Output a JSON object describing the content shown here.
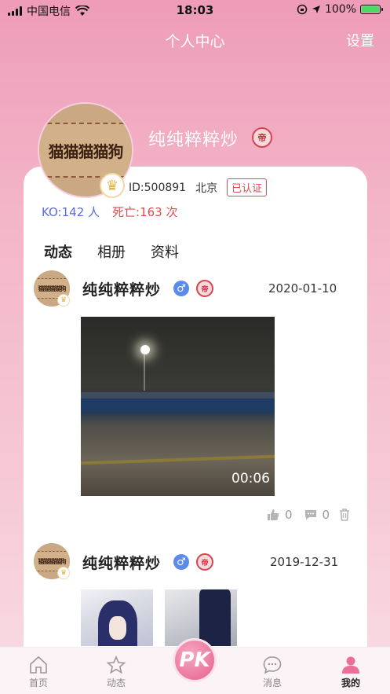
{
  "status_bar": {
    "carrier": "中国电信",
    "time": "18:03",
    "battery": "100%"
  },
  "nav": {
    "title": "个人中心",
    "settings": "设置"
  },
  "profile": {
    "avatar_text": "猫猫猫猫狗",
    "name": "纯纯粹粹炒",
    "badge_text": "帝",
    "id": "ID:500891",
    "location": "北京",
    "verified": "已认证",
    "ko": "KO:142 人",
    "death": "死亡:163 次"
  },
  "tabs": [
    "动态",
    "相册",
    "资料"
  ],
  "posts": [
    {
      "name": "纯纯粹粹炒",
      "gender": "♂",
      "date": "2020-01-10",
      "duration": "00:06",
      "likes": "0",
      "comments": "0",
      "avatar_text": "猫猫猫猫狗"
    },
    {
      "name": "纯纯粹粹炒",
      "gender": "♂",
      "date": "2019-12-31",
      "avatar_text": "猫猫猫猫狗"
    }
  ],
  "tabbar": {
    "home": "首页",
    "feed": "动态",
    "pk": "PK",
    "messages": "消息",
    "mine": "我的"
  },
  "colors": {
    "accent": "#e8608c",
    "ko": "#5a6be0",
    "death": "#e24c4c"
  }
}
